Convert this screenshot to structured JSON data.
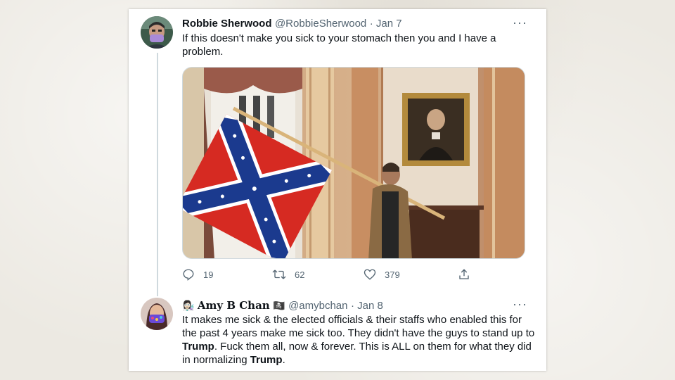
{
  "tweet1": {
    "name": "Robbie Sherwood",
    "handle": "@RobbieSherwood",
    "date": "· Jan 7",
    "text_line1": "If this doesn't make you sick to your stomach then you and I have a",
    "text_line2": "problem.",
    "more": "···",
    "media_icon": "photo-confederate-flag-in-capitol",
    "actions": {
      "replies": "19",
      "retweets": "62",
      "likes": "379"
    }
  },
  "tweet2": {
    "name": "Amy B Chan",
    "name_emoji": "👩🏻‍🔬",
    "name_suffix_emoji": "🏴‍☠️",
    "handle": "@amybchan",
    "date": "· Jan 8",
    "more": "···",
    "line1": "It makes me sick & the elected officials & their staffs who enabled this for",
    "line2": "the past 4 years make me sick too. They didn't have the guys to stand up to",
    "line3_bold": "Trump",
    "line3_rest": ". Fuck them all, now & forever. This is ALL on them for what they did",
    "line4_pre": "in normalizing ",
    "line4_bold": "Trump",
    "line4_post": "."
  },
  "colors": {
    "text": "#0f1419",
    "secondary": "#536471",
    "thread": "#cfd9de",
    "background": "#ece9e2"
  }
}
